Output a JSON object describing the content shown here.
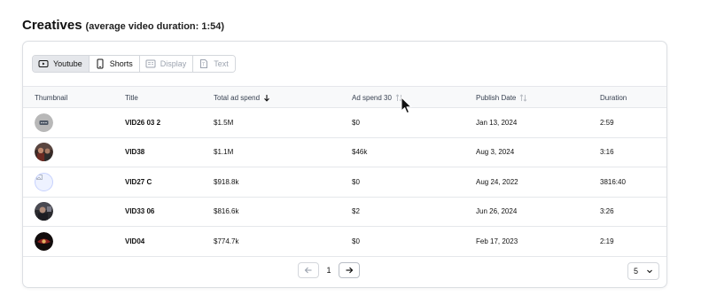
{
  "header": {
    "title": "Creatives",
    "subtitle": "(average video duration: 1:54)"
  },
  "tabs": [
    {
      "label": "Youtube",
      "icon": "youtube-icon",
      "active": true
    },
    {
      "label": "Shorts",
      "icon": "phone-icon",
      "active": false
    },
    {
      "label": "Display",
      "icon": "display-icon",
      "active": false
    },
    {
      "label": "Text",
      "icon": "text-icon",
      "active": false
    }
  ],
  "columns": {
    "thumbnail": "Thumbnail",
    "title": "Title",
    "total_spend": "Total ad spend",
    "spend30": "Ad spend 30",
    "publish": "Publish Date",
    "duration": "Duration"
  },
  "rows": [
    {
      "thumbnail": "placeholder-dots",
      "title": "VID26 03 2",
      "total_spend": "$1.5M",
      "spend30": "$0",
      "publish": "Jan 13, 2024",
      "duration": "2:59"
    },
    {
      "thumbnail": "video-still-people",
      "title": "VID38",
      "total_spend": "$1.1M",
      "spend30": "$46k",
      "publish": "Aug 3, 2024",
      "duration": "3:16"
    },
    {
      "thumbnail": "broken-image",
      "title": "VID27 C",
      "total_spend": "$918.8k",
      "spend30": "$0",
      "publish": "Aug 24, 2022",
      "duration": "3816:40"
    },
    {
      "thumbnail": "video-still-dark",
      "title": "VID33 06",
      "total_spend": "$816.6k",
      "spend30": "$2",
      "publish": "Jun 26, 2024",
      "duration": "3:26"
    },
    {
      "thumbnail": "video-still-red",
      "title": "VID04",
      "total_spend": "$774.7k",
      "spend30": "$0",
      "publish": "Feb 17, 2023",
      "duration": "2:19"
    }
  ],
  "pagination": {
    "current_page": "1",
    "page_size": "5"
  },
  "colors": {
    "border": "#dcdfe3",
    "header_bg": "#f8f9fa",
    "active_tab_bg": "#e5e7eb",
    "text": "#111827"
  }
}
